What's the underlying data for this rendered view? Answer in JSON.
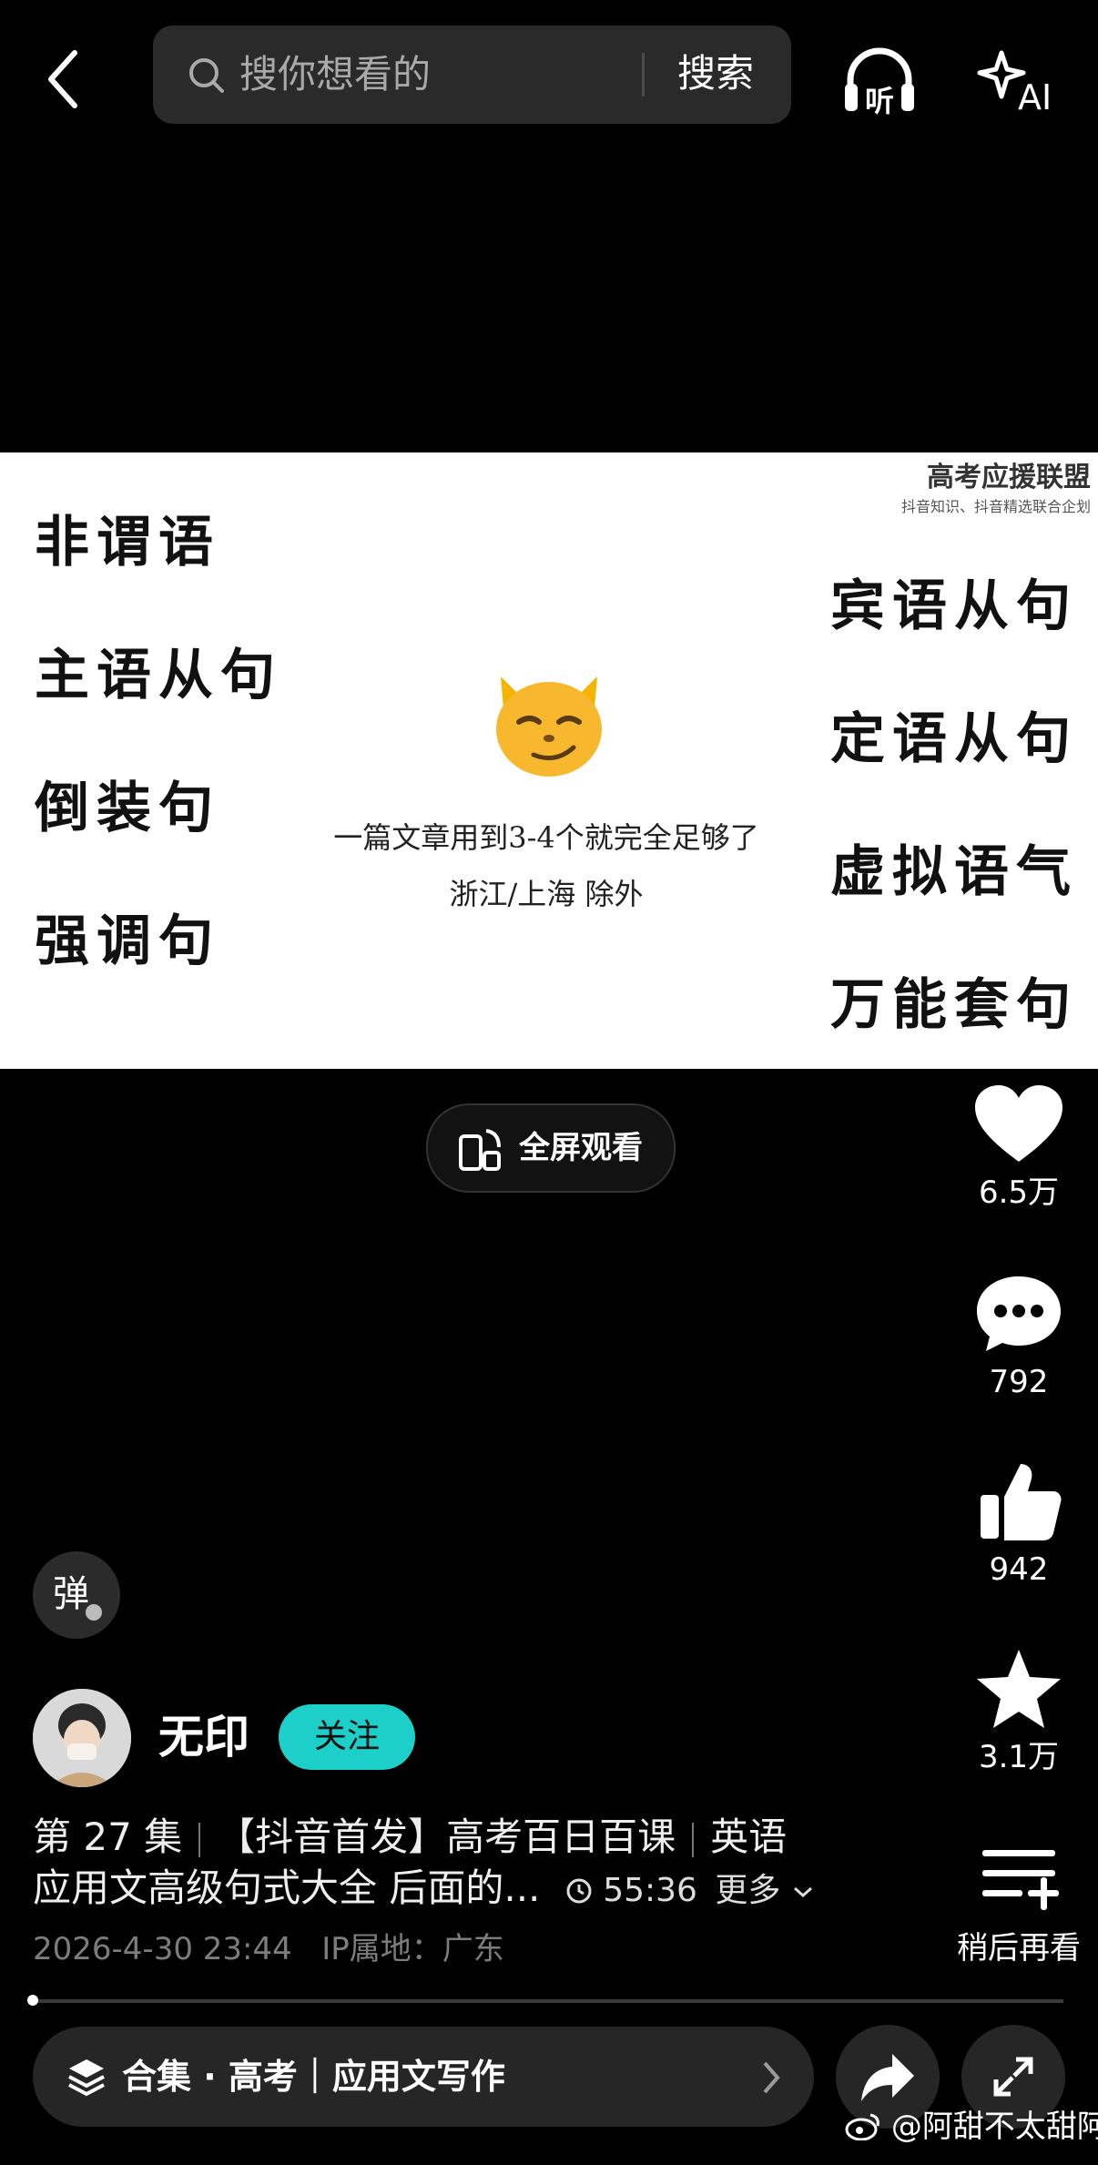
{
  "search": {
    "placeholder": "搜你想看的",
    "button": "搜索"
  },
  "header": {
    "listen_label": "听",
    "ai_label": "AI"
  },
  "video": {
    "watermark_brand": "高考应援联盟",
    "watermark_sub": "抖音知识、抖音精选联合企划",
    "left_items": [
      "非谓语",
      "主语从句",
      "倒装句",
      "强调句"
    ],
    "right_items": [
      "宾语从句",
      "定语从句",
      "虚拟语气",
      "万能套句"
    ],
    "note_line1": "一篇文章用到3-4个就完全足够了",
    "note_line2": "浙江/上海 除外"
  },
  "fullscreen_label": "全屏观看",
  "actions": {
    "like_count": "6.5万",
    "comment_count": "792",
    "recommend_count": "942",
    "favorite_count": "3.1万",
    "later_label": "稍后再看"
  },
  "danmu_label": "弹",
  "author": {
    "name": "无印",
    "follow_label": "关注"
  },
  "description": {
    "episode": "第 27 集",
    "title_part1": "【抖音首发】高考百日百课",
    "title_part2": "英语",
    "title_line2": "应用文高级句式大全 后面的...",
    "duration": "55:36",
    "more_label": "更多"
  },
  "meta": {
    "datetime": "2026-4-30 23:44",
    "ip_label": "IP属地：广东"
  },
  "progress": {
    "fraction": 0.0
  },
  "collection_label": "合集 · 高考｜应用文写作",
  "weibo_watermark": "@阿甜不太甜阿"
}
